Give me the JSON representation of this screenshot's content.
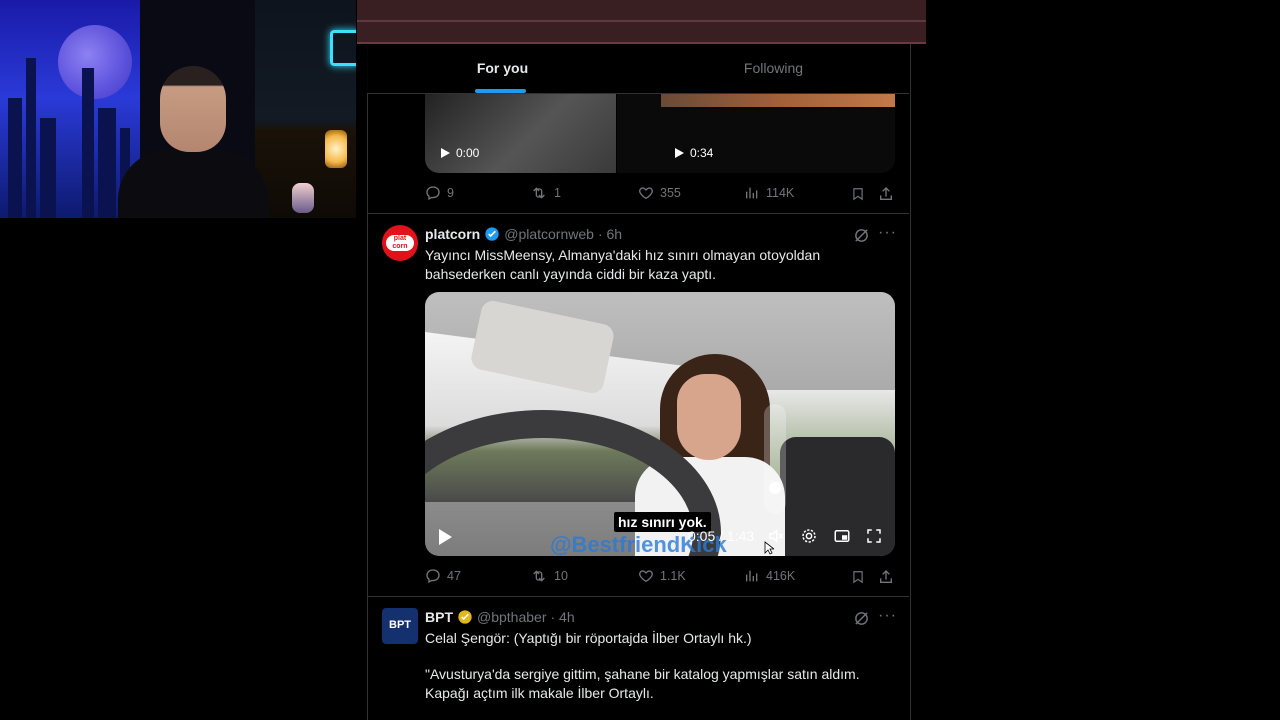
{
  "feed": {
    "tabs": [
      {
        "label": "For you"
      },
      {
        "label": "Following"
      }
    ]
  },
  "prev_tweet": {
    "media": [
      {
        "duration": "0:00"
      },
      {
        "duration": "0:34"
      }
    ],
    "actions": {
      "replies": "9",
      "reposts": "1",
      "likes": "355",
      "views": "114K"
    }
  },
  "tweet1": {
    "author_name": "platcorn",
    "handle": "@platcornweb",
    "time": "· 6h",
    "avatar_text": "plat corn",
    "text_line1": "Yayıncı MissMeensy, Almanya'daki hız sınırı olmayan otoyoldan",
    "text_line2": "bahsederken canlı yayında ciddi bir kaza yaptı.",
    "video": {
      "caption": "hız sınırı yok.",
      "watermark": "@BestfriendKick",
      "time": "0:05 / 1:43",
      "volume_level": 0.15
    },
    "actions": {
      "replies": "47",
      "reposts": "10",
      "likes": "1.1K",
      "views": "416K"
    }
  },
  "tweet2": {
    "author_name": "BPT",
    "handle": "@bpthaber",
    "time": "· 4h",
    "avatar_text": "BPT",
    "text_line1": "Celal Şengör: (Yaptığı bir röportajda İlber Ortaylı hk.)",
    "text_line2": "\"Avusturya'da sergiye gittim, şahane bir katalog yapmışlar satın aldım.",
    "text_line3": "Kapağı açtım ilk makale İlber Ortaylı."
  },
  "colors": {
    "accent": "#1d9bf0",
    "verified_blue": "#1d9bf0",
    "verified_gold": "#e2b719",
    "muted": "#71767b",
    "text": "#e7e9ea"
  }
}
